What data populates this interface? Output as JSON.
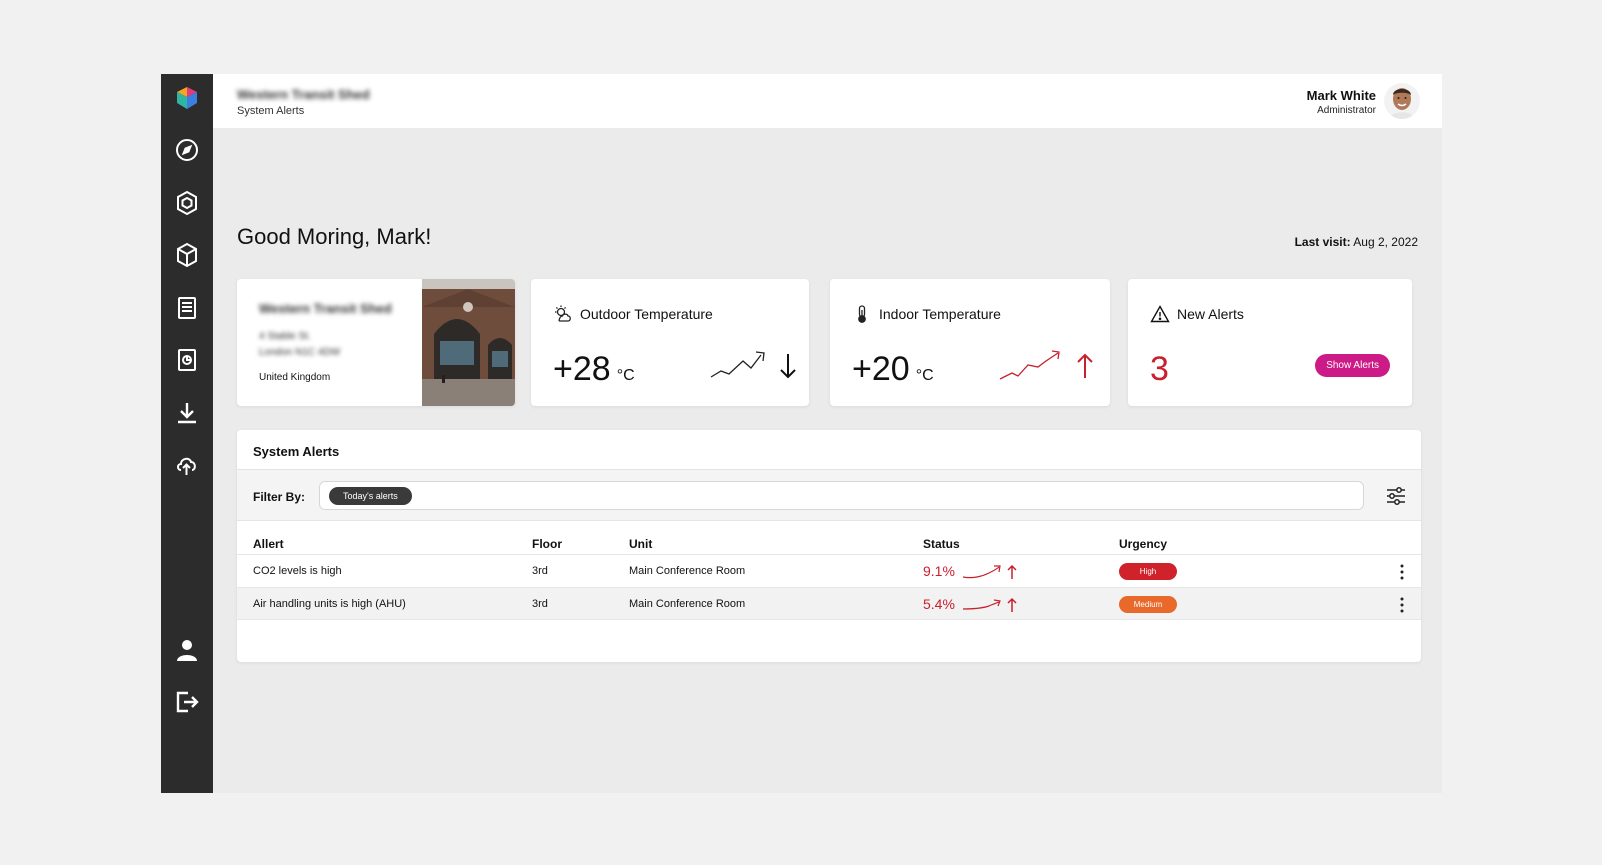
{
  "topbar": {
    "site_name": "Western Transit Shed",
    "breadcrumb": "System Alerts",
    "user_name": "Mark White",
    "user_role": "Administrator"
  },
  "sidebar": {
    "logo_icon": "app-logo-icon",
    "items": [
      {
        "icon": "compass-icon"
      },
      {
        "icon": "hexagon-cube-icon"
      },
      {
        "icon": "box-icon"
      },
      {
        "icon": "document-icon"
      },
      {
        "icon": "report-icon"
      },
      {
        "icon": "download-icon"
      },
      {
        "icon": "cloud-upload-icon"
      }
    ],
    "bottom_items": [
      {
        "icon": "user-icon"
      },
      {
        "icon": "logout-icon"
      }
    ]
  },
  "greeting": "Good Moring, Mark!",
  "last_visit": {
    "label": "Last visit:",
    "value": "Aug 2, 2022"
  },
  "building_card": {
    "name": "Western Transit Shed",
    "address_line1": "4 Stable St.",
    "address_line2": "London N1C 4DW",
    "country": "United Kingdom"
  },
  "outdoor": {
    "title": "Outdoor Temperature",
    "value": "+28",
    "unit": "°C",
    "trend": "down",
    "icon": "sun-cloud-icon"
  },
  "indoor": {
    "title": "Indoor Temperature",
    "value": "+20",
    "unit": "°C",
    "trend": "up",
    "icon": "thermometer-icon"
  },
  "alerts_card": {
    "title": "New Alerts",
    "count": "3",
    "button": "Show Alerts",
    "icon": "warning-icon"
  },
  "system_alerts": {
    "title": "System Alerts",
    "filter_label": "Filter By:",
    "filter_chip": "Today's alerts",
    "columns": [
      "Allert",
      "Floor",
      "Unit",
      "Status",
      "Urgency"
    ],
    "rows": [
      {
        "alert": "CO2 levels is high",
        "floor": "3rd",
        "unit": "Main Conference Room",
        "status": "9.1%",
        "urgency": "High"
      },
      {
        "alert": "Air handling units is high (AHU)",
        "floor": "3rd",
        "unit": "Main Conference Room",
        "status": "5.4%",
        "urgency": "Medium"
      }
    ]
  },
  "colors": {
    "sidebar": "#2c2c2c",
    "accent_pink": "#cc1a86",
    "alert_red": "#c8202e",
    "urgency_high": "#d0222a",
    "urgency_medium": "#e8692a"
  }
}
